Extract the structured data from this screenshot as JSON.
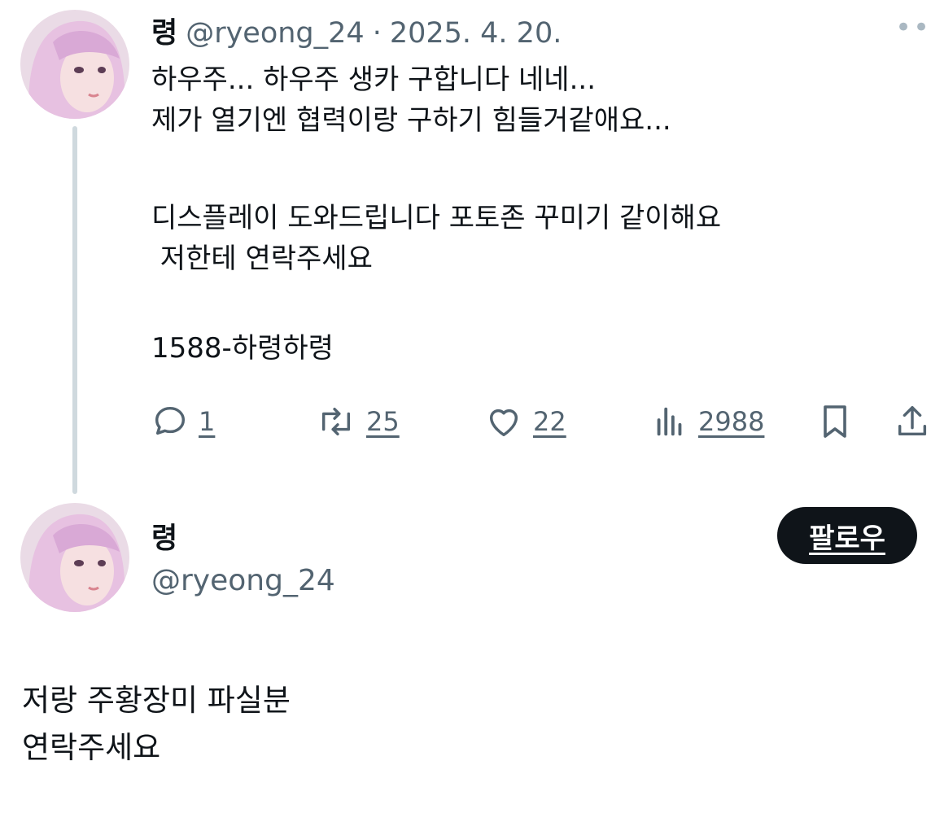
{
  "tweet": {
    "display_name": "령",
    "handle": "@ryeong_24",
    "separator": "·",
    "date": "2025. 4. 20.",
    "more_icon": "ellipsis-icon",
    "lines": [
      "하우주... 하우주 생카 구합니다 네네...",
      "제가 열기엔 협력이랑 구하기 힘들거같애요...",
      "",
      "디스플레이 도와드립니다 포토존 꾸미기 같이해요",
      " 저한테 연락주세요",
      "",
      "",
      "1588-하령하령"
    ],
    "actions": {
      "replies": "1",
      "retweets": "25",
      "likes": "22",
      "views": "2988"
    }
  },
  "profile_card": {
    "display_name": "령",
    "handle": "@ryeong_24",
    "follow_label": "팔로우",
    "bio_lines": [
      "저랑 주황장미 파실분",
      "연락주세요"
    ]
  },
  "colors": {
    "text": "#0f1419",
    "secondary": "#536471",
    "thread_line": "#cfd9de",
    "button_bg": "#0f1419"
  }
}
